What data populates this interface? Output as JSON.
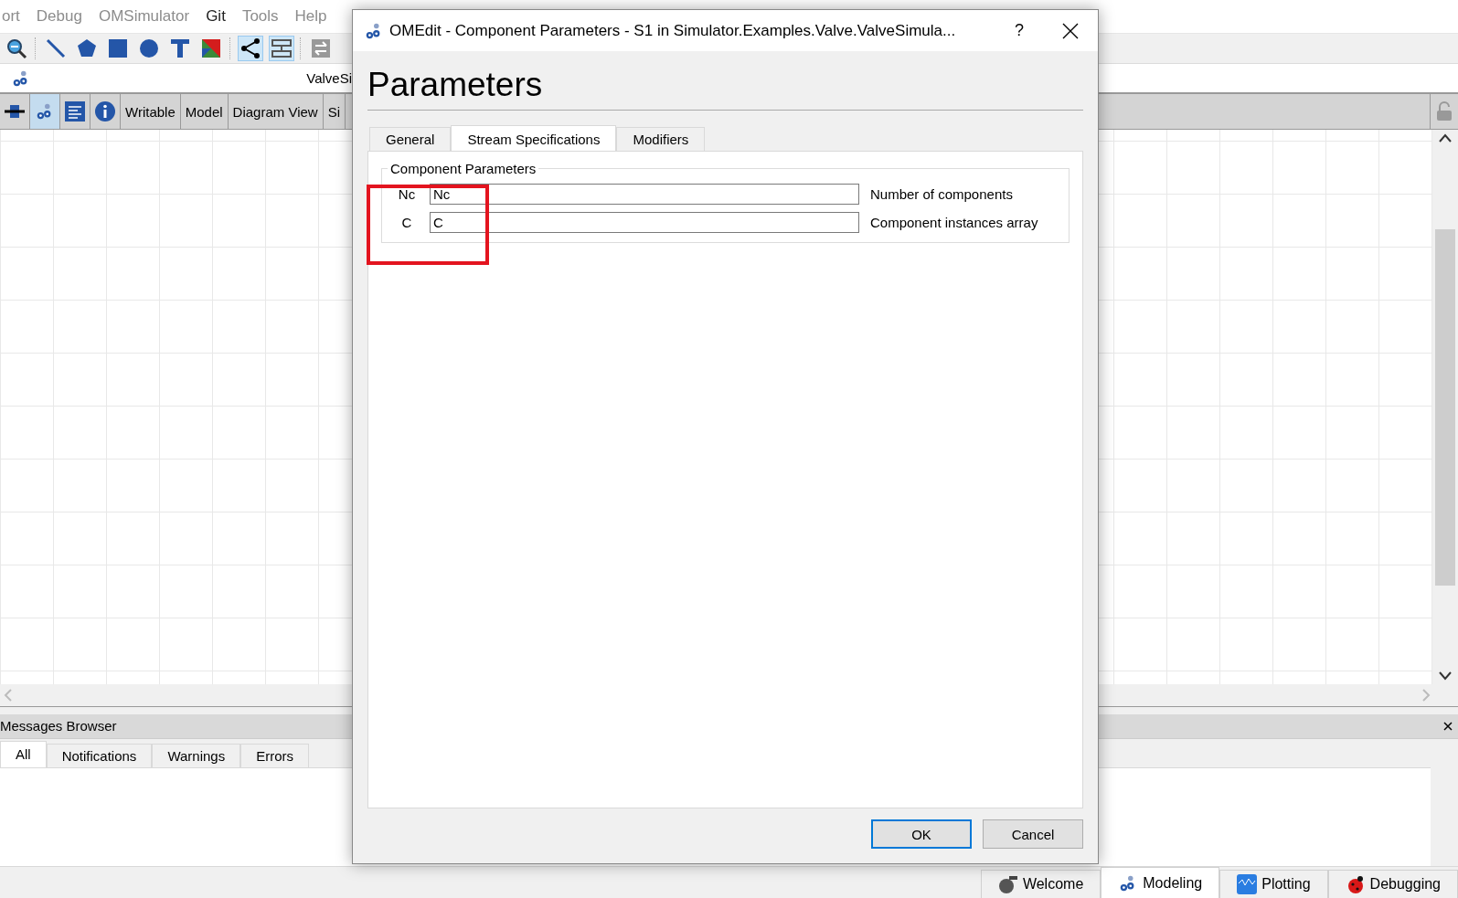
{
  "menu_bar": [
    {
      "label": "ort",
      "disabled": true
    },
    {
      "label": "Debug",
      "disabled": true
    },
    {
      "label": "OMSimulator",
      "disabled": true
    },
    {
      "label": "Git",
      "disabled": false
    },
    {
      "label": "Tools",
      "disabled": true
    },
    {
      "label": "Help",
      "disabled": true
    }
  ],
  "model_title": "ValveSi",
  "model_toolbar": {
    "buttons": [
      "Writable",
      "Model",
      "Diagram View",
      "Si"
    ]
  },
  "messages_browser": {
    "title": "Messages Browser",
    "tabs": [
      {
        "label": "All",
        "selected": true
      },
      {
        "label": "Notifications",
        "selected": false
      },
      {
        "label": "Warnings",
        "selected": false
      },
      {
        "label": "Errors",
        "selected": false
      }
    ]
  },
  "perspective_tabs": [
    {
      "label": "Welcome",
      "selected": false
    },
    {
      "label": "Modeling",
      "selected": true
    },
    {
      "label": "Plotting",
      "selected": false
    },
    {
      "label": "Debugging",
      "selected": false
    }
  ],
  "dialog": {
    "title": "OMEdit - Component Parameters - S1 in Simulator.Examples.Valve.ValveSimula...",
    "help": "?",
    "heading": "Parameters",
    "tabs": [
      {
        "label": "General",
        "selected": false
      },
      {
        "label": "Stream Specifications",
        "selected": true
      },
      {
        "label": "Modifiers",
        "selected": false
      }
    ],
    "group": {
      "title": "Component Parameters",
      "parameters": [
        {
          "name": "Nc",
          "value": "Nc",
          "description": "Number of components"
        },
        {
          "name": "C",
          "value": "C",
          "description": "Component instances array"
        }
      ]
    },
    "buttons": [
      {
        "label": "OK",
        "default": true
      },
      {
        "label": "Cancel",
        "default": false
      }
    ]
  }
}
